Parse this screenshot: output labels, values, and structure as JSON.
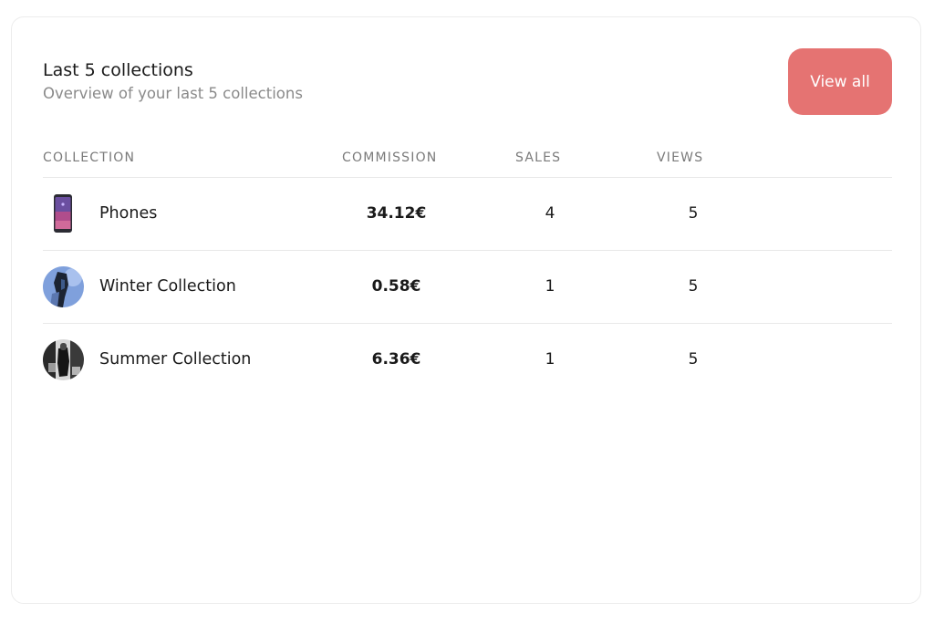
{
  "header": {
    "title": "Last 5 collections",
    "subtitle": "Overview of your last 5 collections",
    "view_all_label": "View all",
    "accent_color": "#e57372"
  },
  "table": {
    "columns": [
      "COLLECTION",
      "COMMISSION",
      "SALES",
      "VIEWS"
    ],
    "rows": [
      {
        "thumbnail": "phone-image",
        "name": "Phones",
        "commission": "34.12€",
        "sales": "4",
        "views": "5"
      },
      {
        "thumbnail": "winter-collection-image",
        "name": "Winter Collection",
        "commission": "0.58€",
        "sales": "1",
        "views": "5"
      },
      {
        "thumbnail": "summer-collection-image",
        "name": "Summer Collection",
        "commission": "6.36€",
        "sales": "1",
        "views": "5"
      }
    ]
  }
}
